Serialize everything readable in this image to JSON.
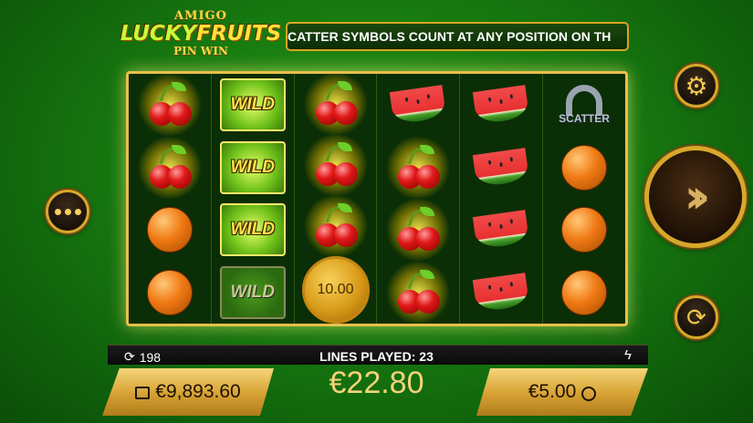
{
  "logo": {
    "top": "AMIGO",
    "main_a": "LUCKY",
    "main_b": "FRUITS",
    "bottom": "PIN WIN"
  },
  "marquee": {
    "text": "CATTER SYMBOLS COUNT AT ANY POSITION ON TH"
  },
  "reels": [
    [
      {
        "symbol": "cherry",
        "glow": true
      },
      {
        "symbol": "cherry",
        "glow": true
      },
      {
        "symbol": "orange"
      },
      {
        "symbol": "orange"
      }
    ],
    [
      {
        "symbol": "wild",
        "label": "WILD"
      },
      {
        "symbol": "wild",
        "label": "WILD"
      },
      {
        "symbol": "wild",
        "label": "WILD"
      },
      {
        "symbol": "wild-dim",
        "label": "WILD"
      }
    ],
    [
      {
        "symbol": "cherry",
        "glow": true
      },
      {
        "symbol": "cherry",
        "glow": true
      },
      {
        "symbol": "cherry",
        "glow": true
      },
      {
        "symbol": "coin",
        "label": "10.00"
      }
    ],
    [
      {
        "symbol": "watermelon"
      },
      {
        "symbol": "cherry",
        "glow": true
      },
      {
        "symbol": "cherry",
        "glow": true
      },
      {
        "symbol": "cherry",
        "glow": true
      }
    ],
    [
      {
        "symbol": "watermelon"
      },
      {
        "symbol": "watermelon"
      },
      {
        "symbol": "watermelon"
      },
      {
        "symbol": "watermelon"
      }
    ],
    [
      {
        "symbol": "scatter",
        "label": "SCATTER"
      },
      {
        "symbol": "orange"
      },
      {
        "symbol": "orange"
      },
      {
        "symbol": "orange"
      }
    ]
  ],
  "controls": {
    "menu_icon": "more-dots-icon",
    "settings_icon": "gear-icon",
    "spin_icon": "double-chevron-right-icon",
    "autoplay_icon": "autoplay-arrows-icon",
    "spins_icon": "refresh-icon",
    "turbo_icon": "lightning-icon"
  },
  "status": {
    "spins_count": "198",
    "lines_played": "LINES PLAYED: 23",
    "total_bet": "€22.80",
    "balance": "€9,893.60",
    "stake": "€5.00"
  }
}
